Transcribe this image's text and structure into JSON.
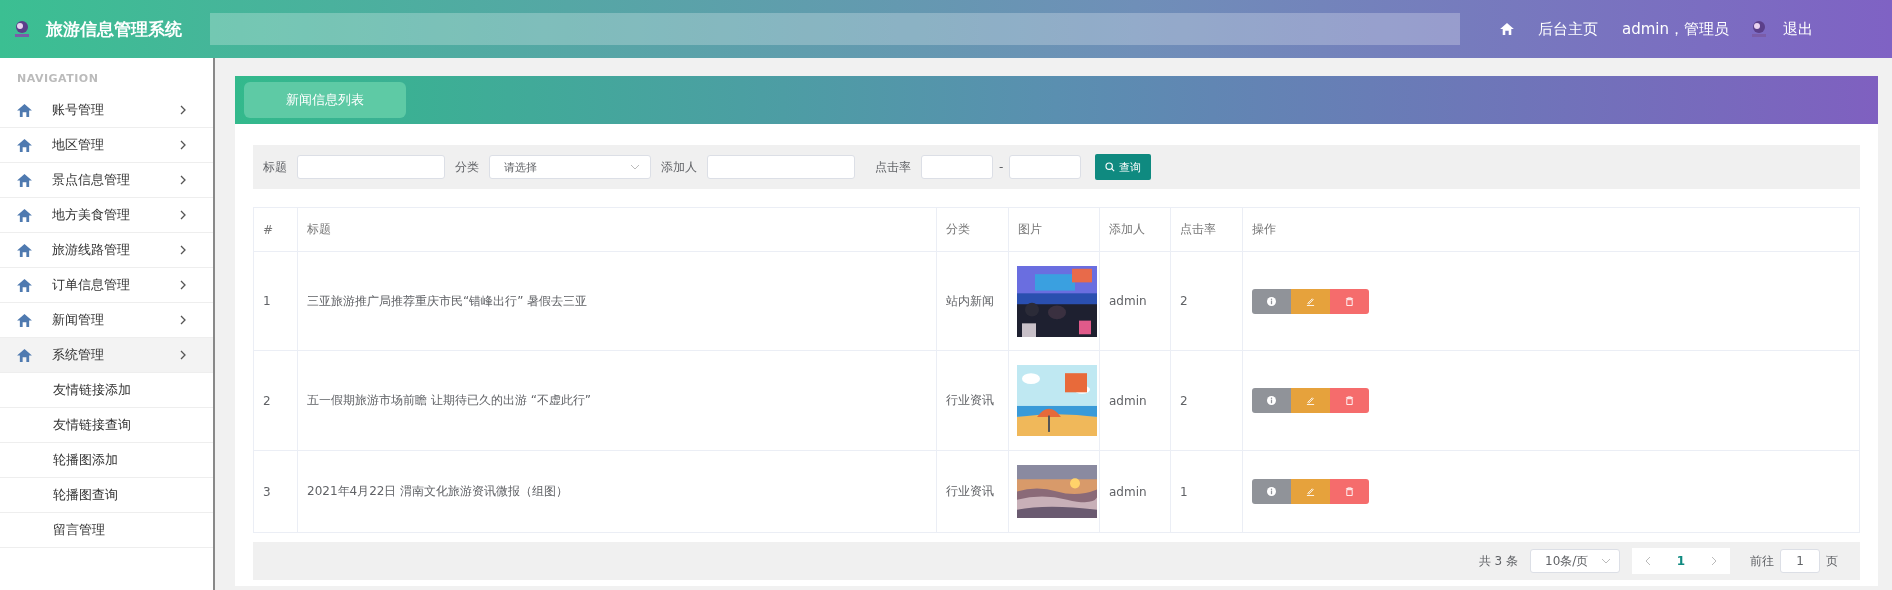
{
  "header": {
    "title": "旅游信息管理系统",
    "links": [
      {
        "kind": "home",
        "label": "后台主页"
      },
      {
        "kind": "user",
        "label": "admin，管理员"
      },
      {
        "kind": "logout",
        "label": "退出"
      }
    ]
  },
  "sidebar": {
    "heading": "NAVIGATION",
    "items": [
      {
        "label": "账号管理",
        "expanded": false
      },
      {
        "label": "地区管理",
        "expanded": false
      },
      {
        "label": "景点信息管理",
        "expanded": false
      },
      {
        "label": "地方美食管理",
        "expanded": false
      },
      {
        "label": "旅游线路管理",
        "expanded": false
      },
      {
        "label": "订单信息管理",
        "expanded": false
      },
      {
        "label": "新闻管理",
        "expanded": false
      },
      {
        "label": "系统管理",
        "expanded": true,
        "children": [
          {
            "label": "友情链接添加"
          },
          {
            "label": "友情链接查询"
          },
          {
            "label": "轮播图添加"
          },
          {
            "label": "轮播图查询"
          },
          {
            "label": "留言管理"
          }
        ]
      }
    ]
  },
  "tab": {
    "label": "新闻信息列表"
  },
  "filters": {
    "title_label": "标题",
    "category_label": "分类",
    "category_placeholder": "请选择",
    "adder_label": "添加人",
    "clicks_label": "点击率",
    "range_sep": "-",
    "search_button": "查询"
  },
  "table": {
    "columns": [
      "#",
      "标题",
      "分类",
      "图片",
      "添加人",
      "点击率",
      "操作"
    ],
    "rows": [
      {
        "index": "1",
        "title": "三亚旅游推广局推荐重庆市民“错峰出行” 暑假去三亚",
        "category": "站内新闻",
        "adder": "admin",
        "clicks": "2"
      },
      {
        "index": "2",
        "title": "五一假期旅游市场前瞻 让期待已久的出游 “不虚此行”",
        "category": "行业资讯",
        "adder": "admin",
        "clicks": "2"
      },
      {
        "index": "3",
        "title": "2021年4月22日 渭南文化旅游资讯微报（组图）",
        "category": "行业资讯",
        "adder": "admin",
        "clicks": "1"
      }
    ]
  },
  "pagination": {
    "total": "共 3 条",
    "page_size": "10条/页",
    "pages": [
      {
        "label": "1",
        "selected": true
      }
    ],
    "goto_label": "前往",
    "goto_value": "1",
    "page_suffix": "页"
  }
}
